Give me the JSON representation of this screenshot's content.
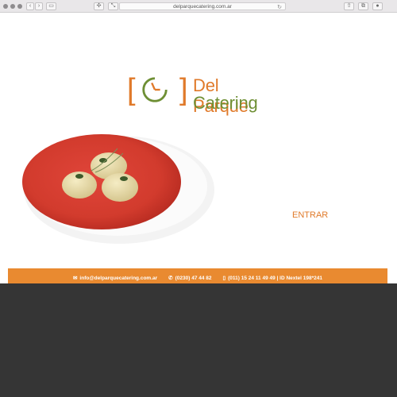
{
  "browser": {
    "address": "delparquecatering.com.ar"
  },
  "logo": {
    "bracket_left": "[",
    "bracket_right": "]",
    "line1": "Del Parque",
    "line2": "Catering"
  },
  "cta": {
    "label": "ENTRAR"
  },
  "contact": {
    "email": "info@delparquecatering.com.ar",
    "phone": "(0230) 47 44 82",
    "mobile": "(011) 15 24 11 49 49 | ID Nextel 198*241"
  },
  "colors": {
    "orange": "#e98a30",
    "green": "#6e8f34",
    "footer": "#353535"
  }
}
